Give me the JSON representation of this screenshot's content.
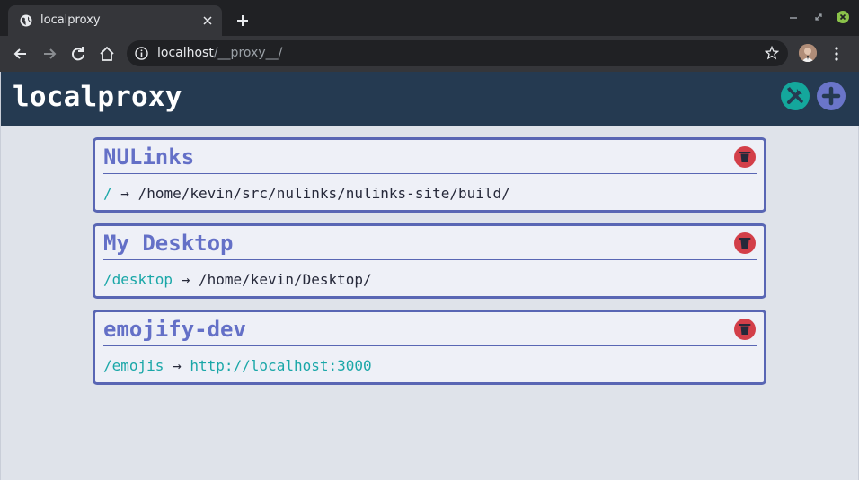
{
  "browser": {
    "tab_title": "localproxy",
    "url_host": "localhost",
    "url_path": "/__proxy__/"
  },
  "app": {
    "title": "localproxy"
  },
  "proxies": [
    {
      "name": "NULinks",
      "path": "/",
      "arrow": "→",
      "target": "/home/kevin/src/nulinks/nulinks-site/build/",
      "target_is_url": false
    },
    {
      "name": "My Desktop",
      "path": "/desktop",
      "arrow": "→",
      "target": "/home/kevin/Desktop/",
      "target_is_url": false
    },
    {
      "name": "emojify-dev",
      "path": "/emojis",
      "arrow": "→",
      "target": "http://localhost:3000",
      "target_is_url": true
    }
  ],
  "colors": {
    "header_bg": "#253a51",
    "accent": "#5966b4",
    "path": "#1aa7a8",
    "delete": "#d33f49",
    "settings": "#14a79c"
  },
  "icons": {
    "settings": "tools-icon",
    "add": "plus-icon",
    "delete": "trash-icon"
  }
}
